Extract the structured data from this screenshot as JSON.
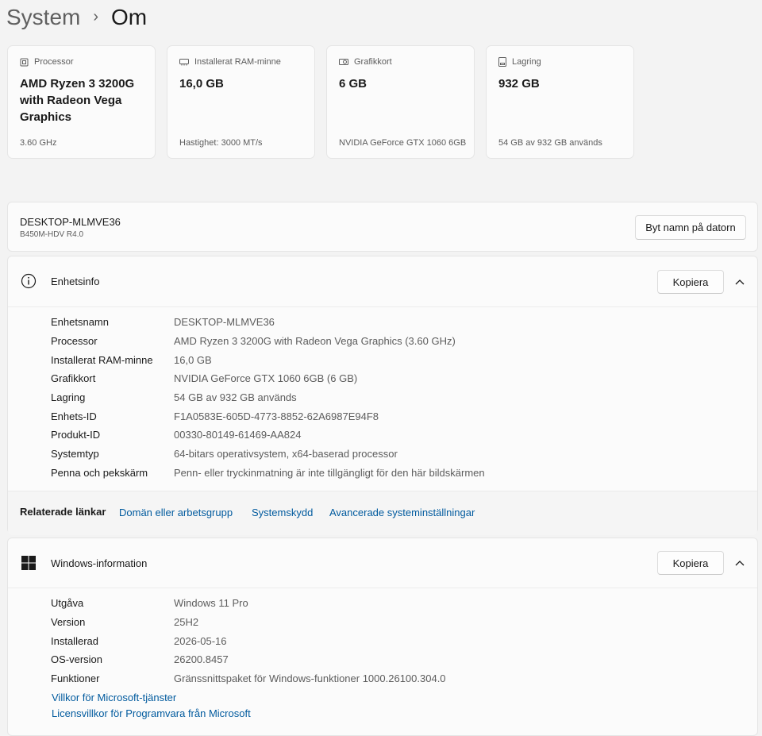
{
  "breadcrumb": {
    "parent": "System",
    "separator": "›",
    "current": "Om"
  },
  "spec_cards": [
    {
      "label": "Processor",
      "value": "AMD Ryzen 3 3200G with Radeon Vega Graphics",
      "sub": "3.60 GHz",
      "icon": "processor-icon"
    },
    {
      "label": "Installerat RAM-minne",
      "value": "16,0 GB",
      "sub": "Hastighet: 3000 MT/s",
      "icon": "ram-icon"
    },
    {
      "label": "Grafikkort",
      "value": "6 GB",
      "sub": "NVIDIA GeForce GTX 1060 6GB",
      "icon": "graphics-card-icon"
    },
    {
      "label": "Lagring",
      "value": "932 GB",
      "sub": "54 GB av 932 GB används",
      "icon": "storage-icon"
    }
  ],
  "computer": {
    "name": "DESKTOP-MLMVE36",
    "model": "B450M-HDV R4.0",
    "rename_button": "Byt namn på datorn"
  },
  "device_info": {
    "title": "Enhetsinfo",
    "copy_button": "Kopiera",
    "rows": [
      {
        "key": "Enhetsnamn",
        "value": "DESKTOP-MLMVE36"
      },
      {
        "key": "Processor",
        "value": "AMD Ryzen 3 3200G with Radeon Vega Graphics (3.60 GHz)"
      },
      {
        "key": "Installerat RAM-minne",
        "value": "16,0 GB"
      },
      {
        "key": "Grafikkort",
        "value": "NVIDIA GeForce GTX 1060 6GB (6 GB)"
      },
      {
        "key": "Lagring",
        "value": "54 GB av 932 GB används"
      },
      {
        "key": "Enhets-ID",
        "value": "F1A0583E-605D-4773-8852-62A6987E94F8"
      },
      {
        "key": "Produkt-ID",
        "value": "00330-80149-61469-AA824"
      },
      {
        "key": "Systemtyp",
        "value": "64-bitars operativsystem, x64-baserad processor"
      },
      {
        "key": "Penna och pekskärm",
        "value": "Penn- eller tryckinmatning är inte tillgängligt för den här bildskärmen"
      }
    ],
    "related_label": "Relaterade länkar",
    "related_links": [
      "Domän eller arbetsgrupp",
      "Systemskydd",
      "Avancerade systeminställningar"
    ]
  },
  "windows_info": {
    "title": "Windows-information",
    "copy_button": "Kopiera",
    "rows": [
      {
        "key": "Utgåva",
        "value": "Windows 11 Pro"
      },
      {
        "key": "Version",
        "value": "25H2"
      },
      {
        "key": "Installerad",
        "value": "2026-05-16"
      },
      {
        "key": "OS-version",
        "value": "26200.8457"
      },
      {
        "key": "Funktioner",
        "value": "Gränssnittspaket för Windows-funktioner 1000.26100.304.0"
      }
    ],
    "links": [
      "Villkor för Microsoft-tjänster",
      "Licensvillkor för Programvara från Microsoft"
    ]
  },
  "colors": {
    "background": "#f3f3f3",
    "card": "#fbfbfb",
    "link": "#005a9e",
    "secondary_text": "#5c5c5c"
  }
}
